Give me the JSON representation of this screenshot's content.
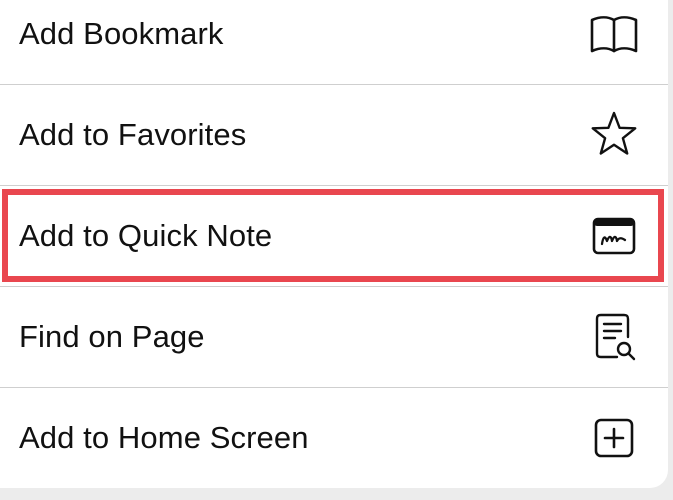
{
  "menu": {
    "items": [
      {
        "label": "Add Bookmark",
        "icon": "book-icon"
      },
      {
        "label": "Add to Favorites",
        "icon": "star-icon"
      },
      {
        "label": "Add to Quick Note",
        "icon": "quick-note-icon"
      },
      {
        "label": "Find on Page",
        "icon": "find-on-page-icon"
      },
      {
        "label": "Add to Home Screen",
        "icon": "add-square-icon"
      }
    ]
  },
  "colors": {
    "highlight_border": "#e9474f",
    "divider": "#cfcfcf",
    "text": "#111111",
    "background": "#ececec"
  }
}
